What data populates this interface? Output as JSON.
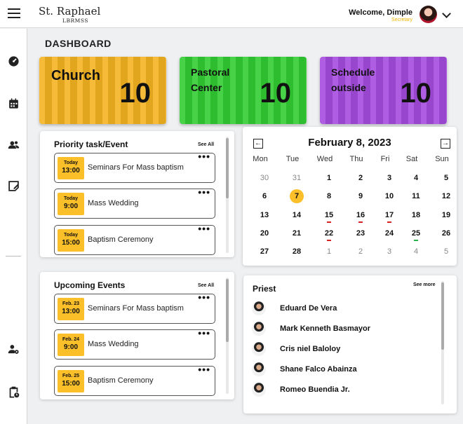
{
  "header": {
    "brand_name": "St. Raphael",
    "brand_sub": "LBRMSS",
    "welcome": "Welcome, Dimple",
    "role": "Secretary"
  },
  "sidebar": {
    "icons": [
      "dashboard-icon",
      "calendar-icon",
      "users-icon",
      "edit-note-icon",
      "user-settings-icon",
      "clipboard-clock-icon"
    ]
  },
  "page": {
    "title": "DASHBOARD"
  },
  "stats": [
    {
      "label_line1": "Church",
      "label_line2": "",
      "value": "10",
      "color": "#f5b321"
    },
    {
      "label_line1": "Pastoral",
      "label_line2": "Center",
      "value": "10",
      "color": "#32cd32"
    },
    {
      "label_line1": "Schedule",
      "label_line2": "outside",
      "value": "10",
      "color": "#a64ce0"
    }
  ],
  "priority": {
    "title": "Priority task/Event",
    "see_all": "See All",
    "items": [
      {
        "day": "Today",
        "time": "13:00",
        "title": "Seminars For Mass baptism"
      },
      {
        "day": "Today",
        "time": "9:00",
        "title": "Mass Wedding"
      },
      {
        "day": "Today",
        "time": "15:00",
        "title": "Baptism Ceremony"
      }
    ]
  },
  "upcoming": {
    "title": "Upcoming Events",
    "see_all": "See All",
    "items": [
      {
        "day": "Feb. 23",
        "time": "13:00",
        "title": "Seminars For Mass baptism"
      },
      {
        "day": "Feb. 24",
        "time": "9:00",
        "title": "Mass Wedding"
      },
      {
        "day": "Feb. 25",
        "time": "15:00",
        "title": "Baptism Ceremony"
      }
    ]
  },
  "calendar": {
    "title": "February 8, 2023",
    "prev": "←",
    "next": "→",
    "weekdays": [
      "Mon",
      "Tue",
      "Wed",
      "Thu",
      "Fri",
      "Sat",
      "Sun"
    ],
    "weeks": [
      [
        {
          "d": "30",
          "muted": true
        },
        {
          "d": "31",
          "muted": true
        },
        {
          "d": "1"
        },
        {
          "d": "2"
        },
        {
          "d": "3"
        },
        {
          "d": "4"
        },
        {
          "d": "5"
        }
      ],
      [
        {
          "d": "6"
        },
        {
          "d": "7",
          "today": true
        },
        {
          "d": "8"
        },
        {
          "d": "9"
        },
        {
          "d": "10"
        },
        {
          "d": "11"
        },
        {
          "d": "12"
        }
      ],
      [
        {
          "d": "13"
        },
        {
          "d": "14"
        },
        {
          "d": "15",
          "mark": "red"
        },
        {
          "d": "16",
          "mark": "red"
        },
        {
          "d": "17",
          "mark": "red"
        },
        {
          "d": "18"
        },
        {
          "d": "19"
        }
      ],
      [
        {
          "d": "20"
        },
        {
          "d": "21"
        },
        {
          "d": "22",
          "mark": "red"
        },
        {
          "d": "23"
        },
        {
          "d": "24"
        },
        {
          "d": "25",
          "mark": "green"
        },
        {
          "d": "26"
        }
      ],
      [
        {
          "d": "27"
        },
        {
          "d": "28"
        },
        {
          "d": "1",
          "muted": true
        },
        {
          "d": "2",
          "muted": true
        },
        {
          "d": "3",
          "muted": true
        },
        {
          "d": "4",
          "muted": true
        },
        {
          "d": "5",
          "muted": true
        }
      ]
    ]
  },
  "priests": {
    "title": "Priest",
    "see_more": "See more",
    "names": [
      "Eduard De Vera",
      "Mark Kenneth Basmayor",
      "Cris niel Baloloy",
      "Shane Falco Abainza",
      "Romeo Buendia Jr."
    ]
  }
}
